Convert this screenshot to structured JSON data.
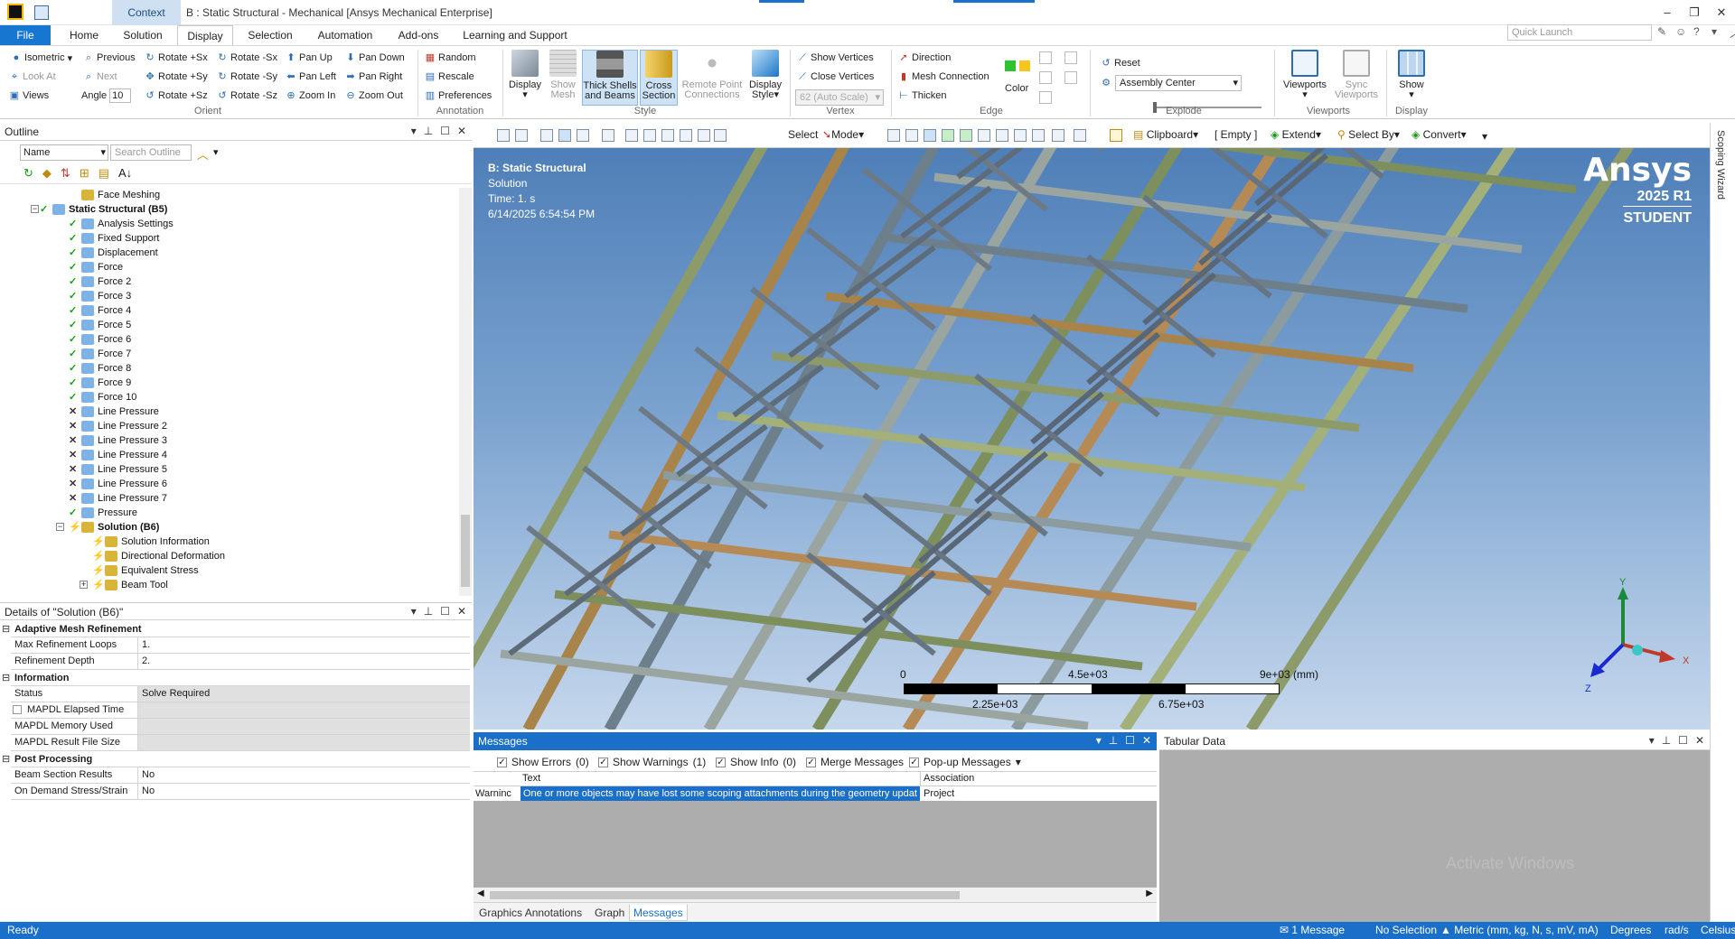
{
  "window": {
    "context_tab": "Context",
    "title": "B : Static Structural - Mechanical [Ansys Mechanical Enterprise]"
  },
  "tabs": [
    "File",
    "Home",
    "Solution",
    "Display",
    "Selection",
    "Automation",
    "Add-ons",
    "Learning and Support"
  ],
  "active_tab": "Display",
  "quick_launch_placeholder": "Quick Launch",
  "ribbon": {
    "orient": {
      "isometric": "Isometric",
      "previous": "Previous",
      "look_at": "Look At",
      "next": "Next",
      "views": "Views",
      "angle_label": "Angle",
      "angle_value": "10",
      "rotate_px": "Rotate +Sx",
      "rotate_py": "Rotate +Sy",
      "rotate_pz": "Rotate +Sz",
      "rotate_mx": "Rotate -Sx",
      "rotate_my": "Rotate -Sy",
      "rotate_mz": "Rotate -Sz",
      "pan_up": "Pan Up",
      "pan_left": "Pan Left",
      "zoom_in": "Zoom In",
      "pan_down": "Pan Down",
      "pan_right": "Pan Right",
      "zoom_out": "Zoom Out",
      "label": "Orient"
    },
    "annotation": {
      "random": "Random",
      "rescale": "Rescale",
      "preferences": "Preferences",
      "label": "Annotation"
    },
    "style": {
      "display": "Display",
      "show_mesh_1": "Show",
      "show_mesh_2": "Mesh",
      "thick_1": "Thick Shells",
      "thick_2": "and Beams",
      "cross_1": "Cross",
      "cross_2": "Section",
      "remote_1": "Remote Point",
      "remote_2": "Connections",
      "dstyle_1": "Display",
      "dstyle_2": "Style",
      "label": "Style"
    },
    "vertex": {
      "show_vertices": "Show Vertices",
      "close_vertices": "Close Vertices",
      "scale": "62 (Auto Scale)",
      "label": "Vertex"
    },
    "edge": {
      "direction": "Direction",
      "mesh_connection": "Mesh Connection",
      "thicken": "Thicken",
      "color": "Color",
      "label": "Edge"
    },
    "explode": {
      "reset": "Reset",
      "assembly_center": "Assembly Center",
      "label": "Explode"
    },
    "viewports": {
      "viewports": "Viewports",
      "sync_1": "Sync",
      "sync_2": "Viewports",
      "label": "Viewports"
    },
    "display_grp": {
      "show": "Show",
      "label": "Display"
    }
  },
  "outline": {
    "title": "Outline",
    "name_select": "Name",
    "search_placeholder": "Search Outline",
    "items": [
      {
        "label": "Face Meshing",
        "state": "none"
      },
      {
        "label": "Static Structural (B5)",
        "state": "check"
      },
      {
        "label": "Analysis Settings",
        "state": "check"
      },
      {
        "label": "Fixed Support",
        "state": "check"
      },
      {
        "label": "Displacement",
        "state": "check"
      },
      {
        "label": "Force",
        "state": "check"
      },
      {
        "label": "Force 2",
        "state": "check"
      },
      {
        "label": "Force 3",
        "state": "check"
      },
      {
        "label": "Force 4",
        "state": "check"
      },
      {
        "label": "Force 5",
        "state": "check"
      },
      {
        "label": "Force 6",
        "state": "check"
      },
      {
        "label": "Force 7",
        "state": "check"
      },
      {
        "label": "Force 8",
        "state": "check"
      },
      {
        "label": "Force 9",
        "state": "check"
      },
      {
        "label": "Force 10",
        "state": "check"
      },
      {
        "label": "Line Pressure",
        "state": "x"
      },
      {
        "label": "Line Pressure 2",
        "state": "x"
      },
      {
        "label": "Line Pressure 3",
        "state": "x"
      },
      {
        "label": "Line Pressure 4",
        "state": "x"
      },
      {
        "label": "Line Pressure 5",
        "state": "x"
      },
      {
        "label": "Line Pressure 6",
        "state": "x"
      },
      {
        "label": "Line Pressure 7",
        "state": "x"
      },
      {
        "label": "Pressure",
        "state": "check"
      },
      {
        "label": "Solution (B6)",
        "state": "bolt"
      },
      {
        "label": "Solution Information",
        "state": "bolt"
      },
      {
        "label": "Directional Deformation",
        "state": "bolt"
      },
      {
        "label": "Equivalent Stress",
        "state": "bolt"
      },
      {
        "label": "Beam Tool",
        "state": "bolt"
      }
    ]
  },
  "details": {
    "title": "Details of \"Solution (B6)\"",
    "groups": [
      {
        "name": "Adaptive Mesh Refinement",
        "rows": [
          {
            "k": "Max Refinement Loops",
            "v": "1."
          },
          {
            "k": "Refinement Depth",
            "v": "2."
          }
        ]
      },
      {
        "name": "Information",
        "rows": [
          {
            "k": "Status",
            "v": "Solve Required"
          },
          {
            "k": "MAPDL Elapsed Time",
            "v": ""
          },
          {
            "k": "MAPDL Memory Used",
            "v": ""
          },
          {
            "k": "MAPDL Result File Size",
            "v": ""
          }
        ]
      },
      {
        "name": "Post Processing",
        "rows": [
          {
            "k": "Beam Section Results",
            "v": "No"
          },
          {
            "k": "On Demand Stress/Strain",
            "v": "No"
          }
        ]
      }
    ]
  },
  "graphics_toolbar": {
    "select": "Select",
    "mode": "Mode",
    "clipboard": "Clipboard",
    "empty": "[ Empty ]",
    "extend": "Extend",
    "select_by": "Select By",
    "convert": "Convert"
  },
  "scoping_wizard": "Scoping Wizard",
  "viewport": {
    "analysis": "B: Static Structural",
    "type": "Solution",
    "time": "Time: 1. s",
    "date": "6/14/2025 6:54:54 PM",
    "brand_1": "Ansys",
    "brand_2": "2025 R1",
    "brand_3": "STUDENT",
    "scale_0": "0",
    "scale_mid": "4.5e+03",
    "scale_max": "9e+03 (mm)",
    "scale_q1": "2.25e+03",
    "scale_q3": "6.75e+03",
    "axis_x": "X",
    "axis_y": "Y",
    "axis_z": "Z"
  },
  "messages": {
    "title": "Messages",
    "show_errors": "Show Errors",
    "errors_count": "(0)",
    "show_warnings": "Show Warnings",
    "warnings_count": "(1)",
    "show_info": "Show Info",
    "info_count": "(0)",
    "merge": "Merge Messages",
    "popup": "Pop-up Messages",
    "col_text": "Text",
    "col_assoc": "Association",
    "row_type": "Warninc",
    "row_text": "One or more objects may have lost some scoping attachments during the geometry updat",
    "row_assoc": "Project",
    "bottom_tabs": [
      "Graphics Annotations",
      "Graph",
      "Messages"
    ]
  },
  "tabular": {
    "title": "Tabular Data",
    "watermark": "Activate Windows"
  },
  "status": {
    "ready": "Ready",
    "messages": "1 Message",
    "selection": "No Selection",
    "units": "Metric (mm, kg, N, s, mV, mA)",
    "angle": "Degrees",
    "rate": "rad/s",
    "temp": "Celsius"
  }
}
